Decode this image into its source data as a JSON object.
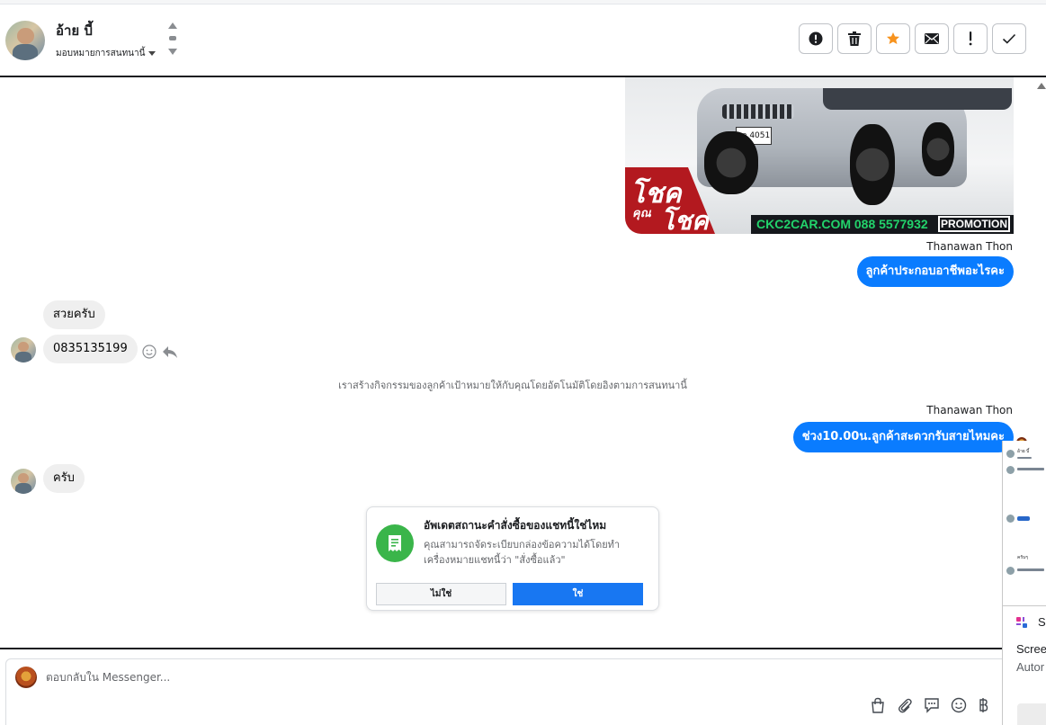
{
  "header": {
    "contact_name": "อ้าย บี้",
    "assign_label": "มอบหมายการสนทนานี้"
  },
  "conversation": {
    "image_ad": {
      "brand": "โชค",
      "sub": "คุณ",
      "brand2": "โชค",
      "website": "CKC2CAR.COM 088 5577932",
      "tag": "PROMOTION",
      "plate": "กจ 4051"
    },
    "sender_1": "Thanawan Thon",
    "out_msg_1": "ลูกค้าประกอบอาชีพอะไรคะ",
    "in_msg_1": "สวยครับ",
    "in_msg_2": "0835135199",
    "system_note": "เราสร้างกิจกรรมของลูกค้าเป้าหมายให้กับคุณโดยอัตโนมัติโดยอิงตามการสนทนานี้",
    "sender_2": "Thanawan Thon",
    "out_msg_2": "ช่วง10.00น.ลูกค้าสะดวกรับสายไหมคะ",
    "in_msg_3": "ครับ"
  },
  "order_card": {
    "title": "อัพเดตสถานะคำสั่งซื้อของแชทนี้ใช่ไหม",
    "body": "คุณสามารถจัดระเบียบกล่องข้อความได้โดยทำเครื่องหมายแชทนี้ว่า \"สั่งซื้อแล้ว\"",
    "no_label": "ไม่ใช่",
    "yes_label": "ใช่"
  },
  "composer": {
    "placeholder": "ตอบกลับใน Messenger..."
  },
  "side_panel": {
    "mini_name": "อ้าย บี้",
    "mini_label": "ครับๆ",
    "tool_name": "Sn",
    "tool_line1": "Scree",
    "tool_line2": "Autor"
  },
  "colors": {
    "accent": "#0a7cff",
    "star": "#f7931e",
    "card_icon": "#3ab54a",
    "yes_button": "#1877f2"
  },
  "icons": {
    "header_actions": [
      "alert-circle-icon",
      "trash-icon",
      "star-icon",
      "envelope-icon",
      "exclamation-icon",
      "check-icon"
    ],
    "message_tools": [
      "smiley-icon",
      "reply-icon"
    ],
    "composer_tools": [
      "shopping-bag-icon",
      "paperclip-icon",
      "saved-reply-icon",
      "emoji-icon",
      "baht-icon"
    ]
  }
}
